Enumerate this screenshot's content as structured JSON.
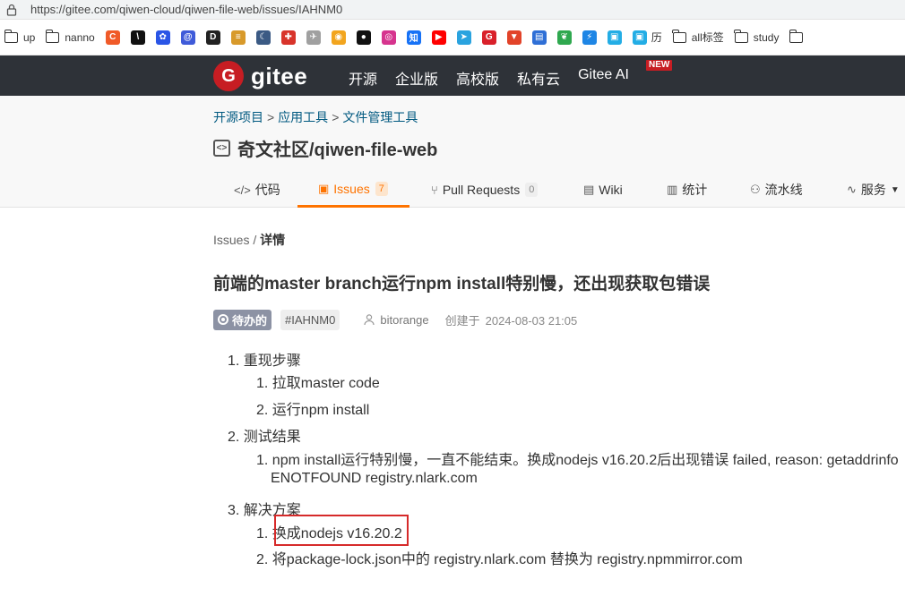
{
  "browser": {
    "url": "https://gitee.com/qiwen-cloud/qiwen-file-web/issues/IAHNM0"
  },
  "bookmarks": [
    {
      "type": "folder",
      "label": "up"
    },
    {
      "type": "folder",
      "label": "nanno"
    },
    {
      "type": "icon",
      "icon": "c-red-icon",
      "label": "",
      "color": "#f05a28",
      "glyph": "C"
    },
    {
      "type": "icon",
      "icon": "slash-black-icon",
      "label": "",
      "color": "#111111",
      "glyph": "\\"
    },
    {
      "type": "icon",
      "icon": "paw-blue-icon",
      "label": "",
      "color": "#2a55e6",
      "glyph": "✿"
    },
    {
      "type": "icon",
      "icon": "at-blue-icon",
      "label": "",
      "color": "#3f5bd9",
      "glyph": "@"
    },
    {
      "type": "icon",
      "icon": "d-black-icon",
      "label": "",
      "color": "#222222",
      "glyph": "D"
    },
    {
      "type": "icon",
      "icon": "burger-icon",
      "label": "",
      "color": "#d89a2b",
      "glyph": "≡"
    },
    {
      "type": "icon",
      "icon": "moon-icon",
      "label": "",
      "color": "#3b5a84",
      "glyph": "☾"
    },
    {
      "type": "icon",
      "icon": "red-tag-icon",
      "label": "",
      "color": "#d8342b",
      "glyph": "✚"
    },
    {
      "type": "icon",
      "icon": "bird-icon",
      "label": "",
      "color": "#a0a0a0",
      "glyph": "✈"
    },
    {
      "type": "icon",
      "icon": "bilibili-yellow-icon",
      "label": "",
      "color": "#f2a51e",
      "glyph": "◉"
    },
    {
      "type": "icon",
      "icon": "github-icon",
      "label": "",
      "color": "#111111",
      "glyph": "●"
    },
    {
      "type": "icon",
      "icon": "instagram-icon",
      "label": "",
      "color": "#d6348e",
      "glyph": "◎"
    },
    {
      "type": "icon",
      "icon": "zhihu-icon",
      "label": "",
      "color": "#1772f6",
      "glyph": "知"
    },
    {
      "type": "icon",
      "icon": "youtube-icon",
      "label": "",
      "color": "#ff0000",
      "glyph": "▶"
    },
    {
      "type": "icon",
      "icon": "telegram-icon",
      "label": "",
      "color": "#2aa3df",
      "glyph": "➤"
    },
    {
      "type": "icon",
      "icon": "g-red-icon",
      "label": "",
      "color": "#d9202a",
      "glyph": "G"
    },
    {
      "type": "icon",
      "icon": "gitlab-icon",
      "label": "",
      "color": "#e24329",
      "glyph": "▼"
    },
    {
      "type": "icon",
      "icon": "doc-blue-icon",
      "label": "",
      "color": "#2f6fd6",
      "glyph": "▤"
    },
    {
      "type": "icon",
      "icon": "evernote-icon",
      "label": "",
      "color": "#2fa84f",
      "glyph": "❦"
    },
    {
      "type": "icon",
      "icon": "bolt-blue-icon",
      "label": "",
      "color": "#1e86e5",
      "glyph": "⚡"
    },
    {
      "type": "icon",
      "icon": "bilibili-tv-icon",
      "label": "",
      "color": "#23ade5",
      "glyph": "▣"
    },
    {
      "type": "icon",
      "icon": "bilibili-tv-icon",
      "label": "历",
      "color": "#23ade5",
      "glyph": "▣"
    },
    {
      "type": "folder",
      "label": "all标签"
    },
    {
      "type": "folder",
      "label": "study"
    },
    {
      "type": "folder",
      "label": ""
    }
  ],
  "header": {
    "logo_mark": "G",
    "logo_text": "gitee",
    "nav": [
      "开源",
      "企业版",
      "高校版",
      "私有云",
      "Gitee AI"
    ],
    "new_badge": "NEW"
  },
  "project": {
    "breadcrumb": [
      "开源项目",
      "应用工具",
      "文件管理工具"
    ],
    "breadcrumb_sep": ">",
    "title": "奇文社区/qiwen-file-web",
    "tabs": [
      {
        "label": "代码",
        "icon": "</>",
        "count": null
      },
      {
        "label": "Issues",
        "icon": "▣",
        "count": "7"
      },
      {
        "label": "Pull Requests",
        "icon": "⑂",
        "count": "0"
      },
      {
        "label": "Wiki",
        "icon": "▤",
        "count": null
      },
      {
        "label": "统计",
        "icon": "▥",
        "count": null
      },
      {
        "label": "流水线",
        "icon": "⚇",
        "count": null
      },
      {
        "label": "服务",
        "icon": "∿",
        "count": null
      }
    ]
  },
  "issue": {
    "breadcrumb_root": "Issues",
    "breadcrumb_sep": "/",
    "breadcrumb_current": "详情",
    "title": "前端的master branch运行npm install特别慢，还出现获取包错误",
    "state": "待办的",
    "ident": "#IAHNM0",
    "author": "bitorange",
    "created_label": "创建于",
    "created_at": "2024-08-03 21:05",
    "body": {
      "s1": "1. 重现步骤",
      "s1_1": "1. 拉取master code",
      "s1_2": "2. 运行npm install",
      "s2": "2. 测试结果",
      "s2_1a": "1. npm install运行特别慢，一直不能结束。换成nodejs v16.20.2后出现错误 failed, reason: getaddrinfo",
      "s2_1b": "ENOTFOUND registry.nlark.com",
      "s3": "3. 解决方案",
      "s3_1": "1. 换成nodejs v16.20.2",
      "s3_2": "2. 将package-lock.json中的 registry.nlark.com 替换为 registry.npmmirror.com"
    }
  },
  "colors": {
    "header_bg": "#2e3238",
    "brand_red": "#c71d23",
    "accent_orange": "#fe7300",
    "link_blue": "#005980",
    "highlight_red": "#d62a2a"
  }
}
